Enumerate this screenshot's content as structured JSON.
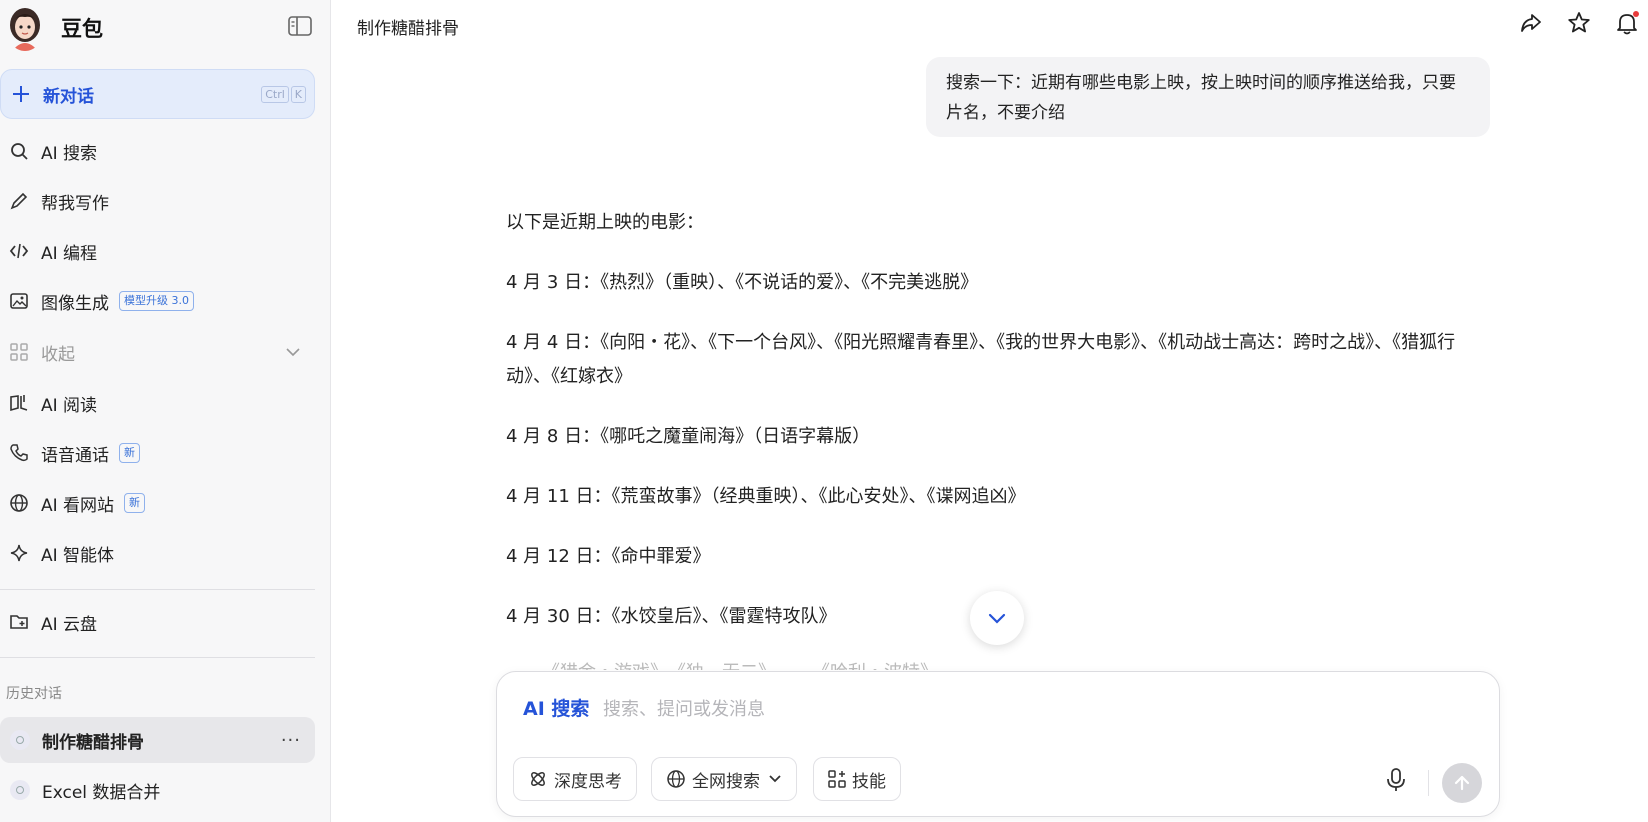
{
  "app": {
    "name": "豆包"
  },
  "sidebar": {
    "new_chat": {
      "label": "新对话",
      "shortcut": [
        "Ctrl",
        "K"
      ]
    },
    "items": [
      {
        "label": "AI 搜索",
        "icon": "search-icon"
      },
      {
        "label": "帮我写作",
        "icon": "pen-icon"
      },
      {
        "label": "AI 编程",
        "icon": "code-icon"
      },
      {
        "label": "图像生成",
        "icon": "image-icon",
        "tag": "模型升级 3.0"
      },
      {
        "label": "收起",
        "icon": "apps-icon"
      },
      {
        "label": "AI 阅读",
        "icon": "book-icon"
      },
      {
        "label": "语音通话",
        "icon": "phone-icon",
        "tag": "新"
      },
      {
        "label": "AI 看网站",
        "icon": "globe-icon",
        "tag": "新"
      },
      {
        "label": "AI 智能体",
        "icon": "sparkle-icon"
      },
      {
        "label": "AI 云盘",
        "icon": "folder-icon"
      }
    ],
    "history_label": "历史对话",
    "history": [
      {
        "title": "制作糖醋排骨",
        "active": true
      },
      {
        "title": "Excel 数据合并",
        "active": false
      }
    ]
  },
  "header": {
    "title": "制作糖醋排骨"
  },
  "conversation": {
    "user_message": "搜索一下：近期有哪些电影上映，按上映时间的顺序推送给我，只要片名，不要介绍",
    "answer_intro": "以下是近期上映的电影：",
    "answer_lines": [
      "4 月 3 日：《热烈》（重映）、《不说话的爱》、《不完美逃脱》",
      "4 月 4 日：《向阳・花》、《下一个台风》、《阳光照耀青春里》、《我的世界大电影》、《机动战士高达：跨时之战》、《猎狐行动》、《红嫁衣》",
      "4 月 8 日：《哪吒之魔童闹海》（日语字幕版）",
      "4 月 11 日：《荒蛮故事》（经典重映）、《此心安处》、《谍网追凶》",
      "4 月 12 日：《命中罪爱》",
      "4 月 30 日：《水饺皇后》、《雷霆特攻队》"
    ],
    "answer_partial": "……《猎金・游戏》、《独一无二》……《哈利・波特》……"
  },
  "composer": {
    "mode": "AI 搜索",
    "placeholder": "搜索、提问或发消息",
    "chips": [
      {
        "label": "深度思考",
        "icon": "deep-think-icon"
      },
      {
        "label": "全网搜索",
        "icon": "globe-icon"
      },
      {
        "label": "技能",
        "icon": "skills-icon"
      }
    ]
  },
  "colors": {
    "accent": "#2553d8",
    "sidebar_bg": "#f7f7f8"
  }
}
